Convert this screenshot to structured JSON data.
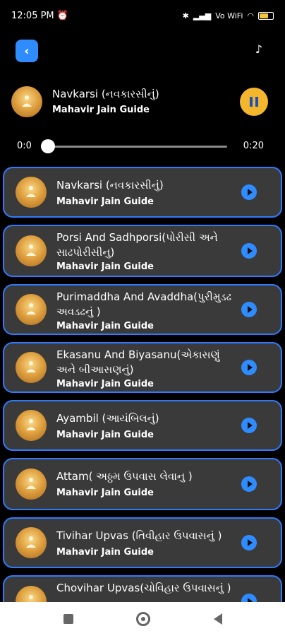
{
  "status_bar": {
    "time": "12:05 PM",
    "network": "Vo WiFi"
  },
  "topbar": {
    "back_icon": "back-icon",
    "music_icon": "music-note-icon"
  },
  "now_playing": {
    "title": "Navkarsi (નવકારસીનું)",
    "subtitle": "Mahavir Jain Guide",
    "state": "playing"
  },
  "progress": {
    "start": "0:0",
    "end": "0:20",
    "position": 0.0
  },
  "list": {
    "items": [
      {
        "title": "Navkarsi (નવકારસીનું)",
        "subtitle": "Mahavir Jain Guide"
      },
      {
        "title": "Porsi And Sadhporsi(પોરીસી અને સાઢપોરીસીનુ)",
        "subtitle": "Mahavir Jain Guide"
      },
      {
        "title": "Purimaddha And Avaddha(પુરીમુડઢ અવડઢનું )",
        "subtitle": "Mahavir Jain Guide"
      },
      {
        "title": "Ekasanu And Biyasanu(એકાસણું અને બીઆસણનું)",
        "subtitle": "Mahavir Jain Guide"
      },
      {
        "title": "Ayambil (આયંબિલનું)",
        "subtitle": "Mahavir Jain Guide"
      },
      {
        "title": "Attam( અઠ્ઠમ ઉપવાસ લેવાનુ )",
        "subtitle": "Mahavir Jain Guide"
      },
      {
        "title": "Tivihar Upvas (તિવીહાર ઉપવાસનું )",
        "subtitle": "Mahavir Jain Guide"
      },
      {
        "title": "Chovihar Upvas(ચોવિહાર ઉપવાસનું )",
        "subtitle": ""
      }
    ]
  },
  "colors": {
    "accent": "#2f8cff",
    "pause": "#f4b62c",
    "card_bg": "#3a3a3a"
  }
}
